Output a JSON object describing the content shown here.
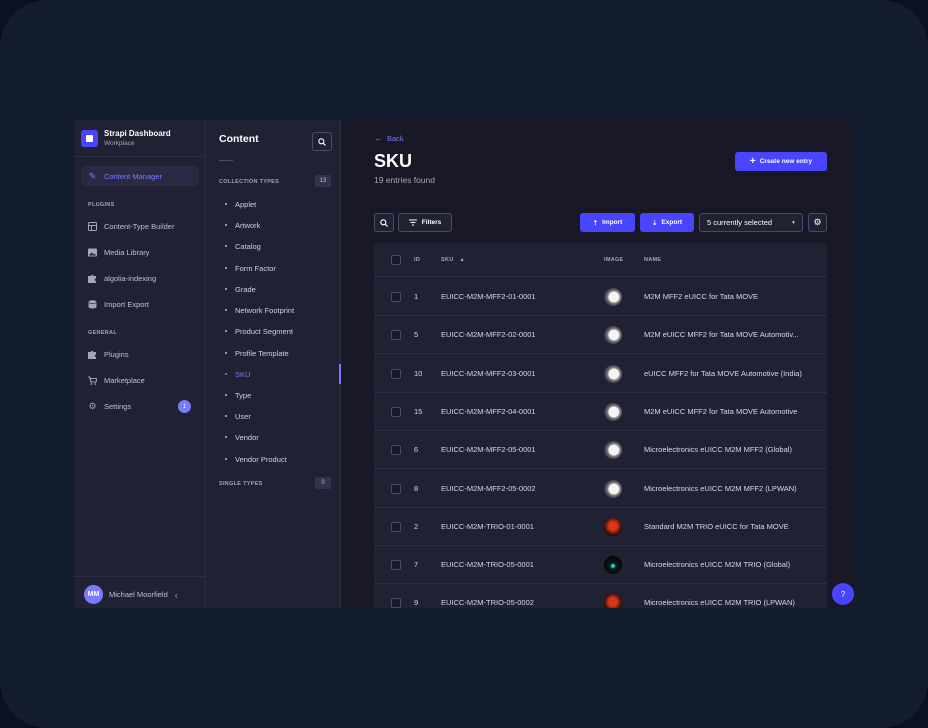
{
  "brand": {
    "title": "Strapi Dashboard",
    "subtitle": "Workplace"
  },
  "sidebar": {
    "active": {
      "label": "Content Manager",
      "icon": "pencil-icon"
    },
    "plugins_title": "PLUGINS",
    "plugins": [
      {
        "label": "Content-Type Builder",
        "icon": "layout-icon"
      },
      {
        "label": "Media Library",
        "icon": "image-icon"
      },
      {
        "label": "algolia-indexing",
        "icon": "puzzle-icon"
      },
      {
        "label": "Import Export",
        "icon": "database-icon"
      }
    ],
    "general_title": "GENERAL",
    "general": [
      {
        "label": "Plugins",
        "icon": "puzzle-icon"
      },
      {
        "label": "Marketplace",
        "icon": "cart-icon"
      },
      {
        "label": "Settings",
        "icon": "gear-icon",
        "badge": "1"
      }
    ],
    "user": {
      "initials": "MM",
      "name": "Michael Moorfield"
    }
  },
  "subnav": {
    "title": "Content",
    "collection_title": "COLLECTION TYPES",
    "collection_count": "13",
    "items": [
      "Applet",
      "Artwork",
      "Catalog",
      "Form Factor",
      "Grade",
      "Network Footprint",
      "Product Segment",
      "Profile Template",
      "SKU",
      "Type",
      "User",
      "Vendor",
      "Vendor Product"
    ],
    "active_item": "SKU",
    "single_title": "SINGLE TYPES",
    "single_count": "0"
  },
  "content": {
    "back_label": "Back",
    "title": "SKU",
    "subtitle": "19 entries found",
    "create_label": "Create new entry",
    "filters_label": "Filters",
    "import_label": "Import",
    "export_label": "Export",
    "selected_label": "5 currently selected"
  },
  "table": {
    "headers": {
      "id": "ID",
      "sku": "SKU",
      "image": "IMAGE",
      "name": "NAME"
    },
    "rows": [
      {
        "id": "1",
        "sku": "EUICC-M2M-MFF2-01-0001",
        "image": "white",
        "name": "M2M MFF2 eUICC for Tata MOVE"
      },
      {
        "id": "5",
        "sku": "EUICC-M2M-MFF2-02-0001",
        "image": "white",
        "name": "M2M eUICC MFF2 for Tata MOVE Automotiv..."
      },
      {
        "id": "10",
        "sku": "EUICC-M2M-MFF2-03-0001",
        "image": "white",
        "name": "eUICC MFF2 for Tata MOVE Automotive (India)"
      },
      {
        "id": "15",
        "sku": "EUICC-M2M-MFF2-04-0001",
        "image": "white",
        "name": "M2M eUICC MFF2 for Tata MOVE Automotive"
      },
      {
        "id": "6",
        "sku": "EUICC-M2M-MFF2-05-0001",
        "image": "white",
        "name": "Microelectronics eUICC M2M MFF2 (Global)"
      },
      {
        "id": "8",
        "sku": "EUICC-M2M-MFF2-05-0002",
        "image": "white",
        "name": "Microelectronics eUICC M2M MFF2 (LPWAN)"
      },
      {
        "id": "2",
        "sku": "EUICC-M2M-TRIO-01-0001",
        "image": "red",
        "name": "Standard M2M TRIO eUICC for Tata MOVE"
      },
      {
        "id": "7",
        "sku": "EUICC-M2M-TRIO-05-0001",
        "image": "dark",
        "name": "Microelectronics eUICC M2M TRIO (Global)"
      },
      {
        "id": "9",
        "sku": "EUICC-M2M-TRIO-05-0002",
        "image": "red",
        "name": "Microelectronics eUICC M2M TRIO (LPWAN)"
      }
    ]
  },
  "help_label": "?",
  "colors": {
    "accent": "#4945ff",
    "accent_light": "#7b79ff",
    "panel": "#212134",
    "background": "#181826"
  }
}
